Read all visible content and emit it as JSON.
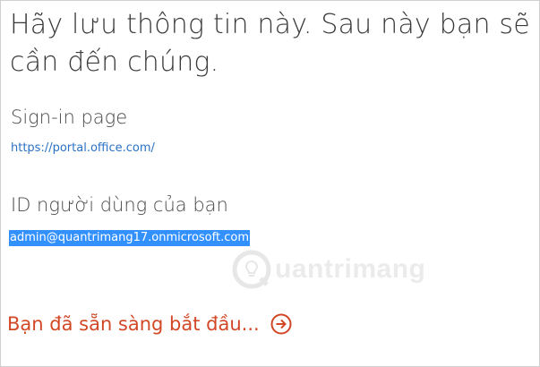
{
  "heading": "Hãy lưu thông tin này. Sau này bạn sẽ cần đến chúng.",
  "signin": {
    "label": "Sign-in page",
    "url": "https://portal.office.com/"
  },
  "user_id": {
    "label": "ID người dùng của bạn",
    "value": "admin@quantrimang17.onmicrosoft.com"
  },
  "start": {
    "label": "Bạn đã sẵn sàng bắt đầu...",
    "icon": "arrow-right-circle-icon"
  },
  "watermark": {
    "text": "uantrimang",
    "icon": "lightbulb-q-icon"
  },
  "colors": {
    "accent_orange": "#d24726",
    "link_blue": "#2a72c5",
    "selection_blue": "#3390ff"
  }
}
